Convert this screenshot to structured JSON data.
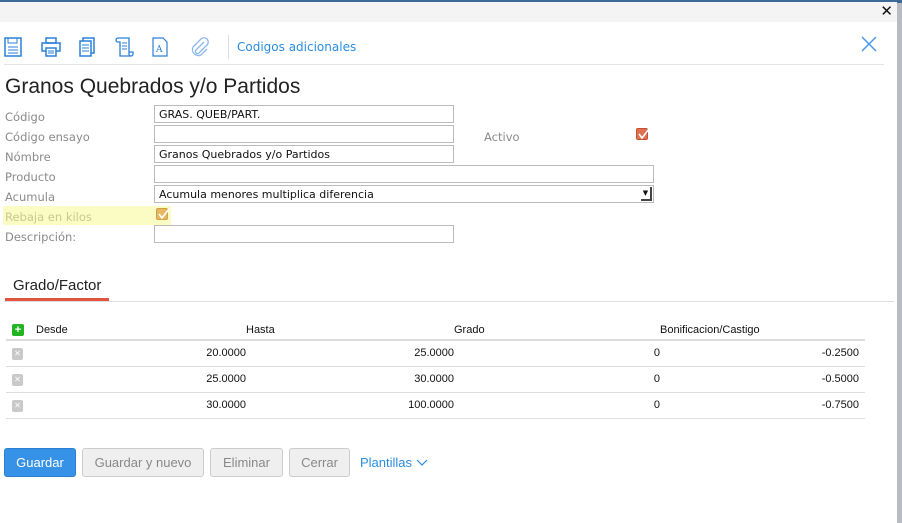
{
  "window": {
    "close_glyph": "✕"
  },
  "toolbar": {
    "icons": [
      "save-icon",
      "print-icon",
      "copy-icon",
      "script-icon",
      "document-font-icon",
      "attachment-icon"
    ],
    "link": "Codigos adicionales"
  },
  "title": "Granos Quebrados y/o Partidos",
  "form": {
    "codigo_label": "Código",
    "codigo_value": "GRAS. QUEB/PART.",
    "codigo_ensayo_label": "Código ensayo",
    "codigo_ensayo_value": "",
    "activo_label": "Activo",
    "activo_checked": true,
    "nombre_label": "Nómbre",
    "nombre_value": "Granos Quebrados y/o Partidos",
    "producto_label": "Producto",
    "producto_value": "",
    "acumula_label": "Acumula",
    "acumula_value": "Acumula menores multiplica diferencia",
    "rebaja_label": "Rebaja en kilos",
    "rebaja_checked": true,
    "descripcion_label": "Descripción:",
    "descripcion_value": ""
  },
  "tab": "Grado/Factor",
  "table": {
    "headers": [
      "Desde",
      "Hasta",
      "Grado",
      "Bonificacion/Castigo"
    ],
    "rows": [
      [
        "20.0000",
        "25.0000",
        "0",
        "-0.2500"
      ],
      [
        "25.0000",
        "30.0000",
        "0",
        "-0.5000"
      ],
      [
        "30.0000",
        "100.0000",
        "0",
        "-0.7500"
      ]
    ]
  },
  "buttons": {
    "guardar": "Guardar",
    "guardar_nuevo": "Guardar y nuevo",
    "eliminar": "Eliminar",
    "cerrar": "Cerrar",
    "plantillas": "Plantillas"
  },
  "colors": {
    "accent": "#3592e6",
    "tab_underline": "#e0533c",
    "checkbox": "#e07050",
    "link": "#2a8ce0"
  }
}
